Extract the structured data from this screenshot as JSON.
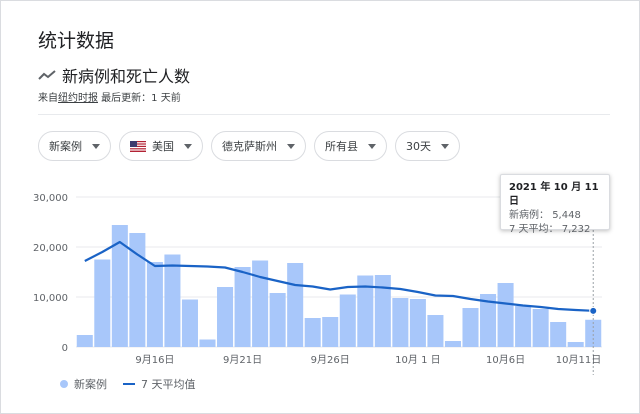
{
  "page": {
    "title": "统计数据",
    "subtitle": "新病例和死亡人数",
    "source_prefix": "来自",
    "source_link": "纽约时报",
    "updated": " 最后更新：1 天前"
  },
  "filters": [
    {
      "label": "新案例",
      "has_flag": false
    },
    {
      "label": "美国",
      "has_flag": true
    },
    {
      "label": "德克萨斯州",
      "has_flag": false
    },
    {
      "label": "所有县",
      "has_flag": false
    },
    {
      "label": "30天",
      "has_flag": false
    }
  ],
  "tooltip": {
    "date": "2021 年 10 月 11 日",
    "cases_label": "新病例：",
    "cases_value": "5,448",
    "avg_label": "7 天平均：",
    "avg_value": "7,232"
  },
  "legend": {
    "bars": "新案例",
    "line": "7 天平均值"
  },
  "colors": {
    "bar": "#a8c7fa",
    "line": "#1a63c6",
    "grid": "#e8eaed"
  },
  "chart_data": {
    "type": "bar",
    "ylim": [
      0,
      30000
    ],
    "yticks": [
      "0",
      "10,000",
      "20,000",
      "30,000"
    ],
    "ytick_values": [
      0,
      10000,
      20000,
      30000
    ],
    "xtick_labels": [
      "9月16日",
      "9月21日",
      "9月26日",
      "10月 1 日",
      "10月6日",
      "10月11日"
    ],
    "xtick_indices": [
      4,
      9,
      14,
      19,
      24,
      29
    ],
    "categories": [
      "9月12日",
      "9月13日",
      "9月14日",
      "9月15日",
      "9月16日",
      "9月17日",
      "9月18日",
      "9月19日",
      "9月20日",
      "9月21日",
      "9月22日",
      "9月23日",
      "9月24日",
      "9月25日",
      "9月26日",
      "9月27日",
      "9月28日",
      "9月29日",
      "9月30日",
      "10月1日",
      "10月2日",
      "10月3日",
      "10月4日",
      "10月5日",
      "10月6日",
      "10月7日",
      "10月8日",
      "10月9日",
      "10月10日",
      "10月11日"
    ],
    "series": [
      {
        "name": "新案例",
        "values": [
          2400,
          17500,
          24400,
          22800,
          17000,
          18500,
          9500,
          1500,
          12000,
          16000,
          17300,
          10800,
          16800,
          5800,
          6000,
          10500,
          14300,
          14400,
          9800,
          9600,
          6400,
          1200,
          7800,
          10600,
          12800,
          8200,
          7600,
          5000,
          1000,
          5448
        ]
      },
      {
        "name": "7 天平均值",
        "values": [
          17200,
          19000,
          21000,
          18500,
          16200,
          16300,
          16200,
          16100,
          15900,
          15000,
          14000,
          13200,
          12400,
          12100,
          11500,
          12000,
          12100,
          11900,
          11600,
          11000,
          10300,
          10200,
          9600,
          9100,
          8700,
          8300,
          8000,
          7600,
          7400,
          7232
        ]
      }
    ]
  }
}
